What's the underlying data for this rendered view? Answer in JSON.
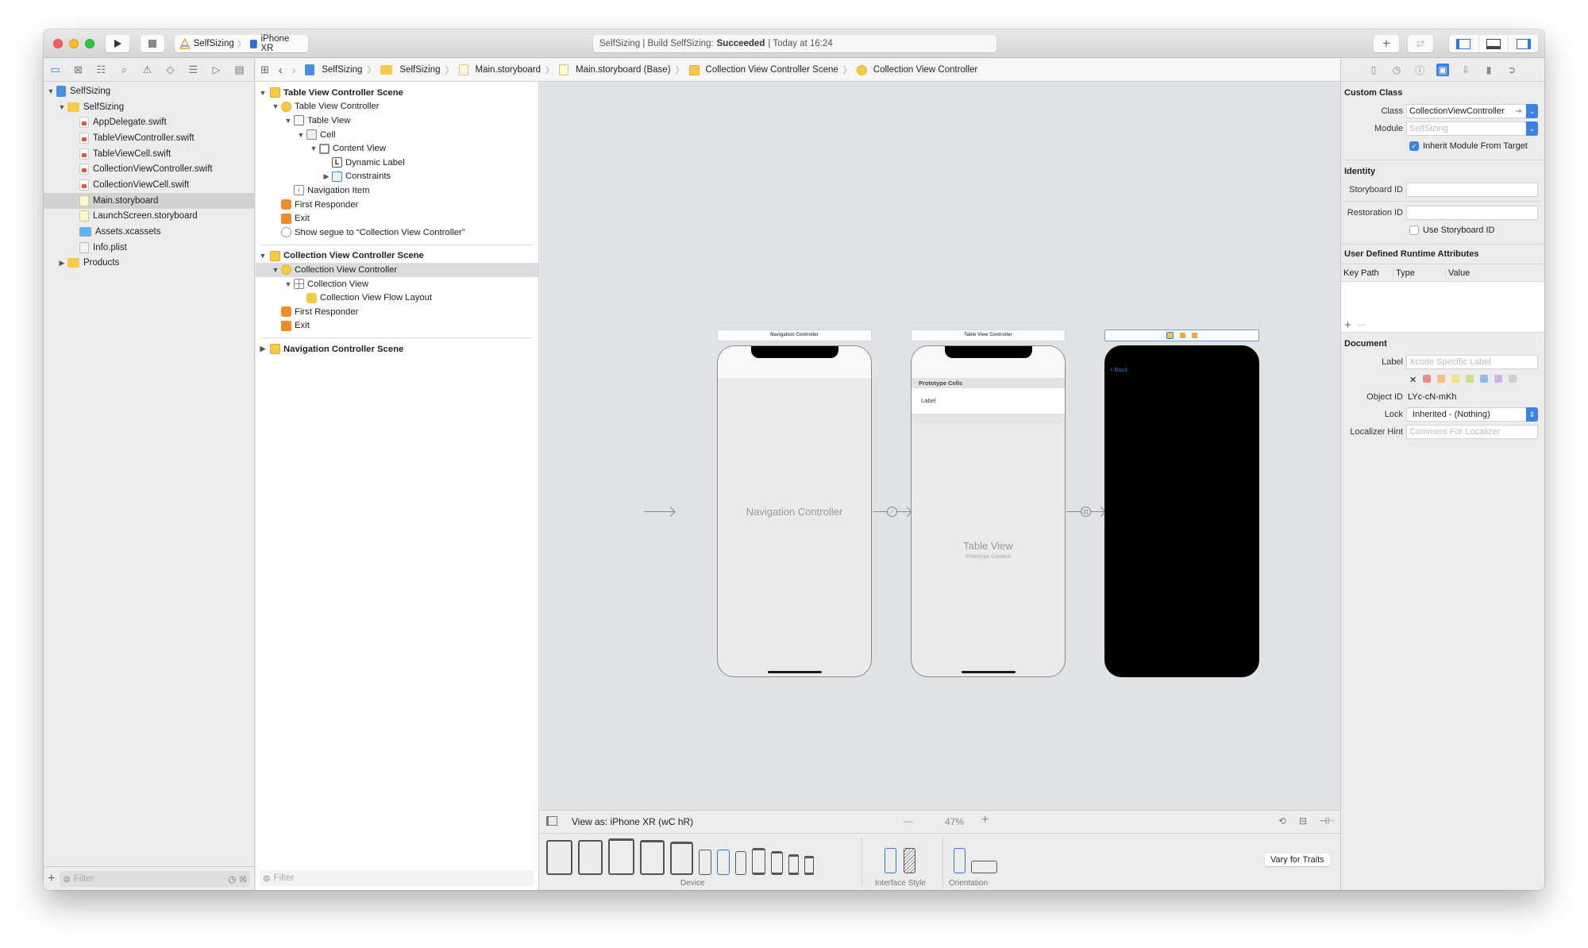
{
  "toolbar": {
    "scheme": "SelfSizing",
    "destination": "iPhone XR",
    "activity_prefix": "SelfSizing | Build SelfSizing:",
    "activity_status": "Succeeded",
    "activity_suffix": "| Today at 16:24"
  },
  "navigator": {
    "tabs": [
      "folder-icon",
      "source-control-icon",
      "symbol-icon",
      "search-icon",
      "warning-icon",
      "test-icon",
      "debug-icon",
      "breakpoint-icon",
      "report-icon"
    ],
    "project": "SelfSizing",
    "group": "SelfSizing",
    "files": [
      {
        "name": "AppDelegate.swift",
        "type": "swift"
      },
      {
        "name": "TableViewController.swift",
        "type": "swift"
      },
      {
        "name": "TableViewCell.swift",
        "type": "swift"
      },
      {
        "name": "CollectionViewController.swift",
        "type": "swift"
      },
      {
        "name": "CollectionViewCell.swift",
        "type": "swift"
      },
      {
        "name": "Main.storyboard",
        "type": "storyboard",
        "selected": true
      },
      {
        "name": "LaunchScreen.storyboard",
        "type": "storyboard"
      },
      {
        "name": "Assets.xcassets",
        "type": "assets"
      },
      {
        "name": "Info.plist",
        "type": "plist"
      }
    ],
    "products": "Products",
    "filter_placeholder": "Filter"
  },
  "pathbar": {
    "crumbs": [
      "SelfSizing",
      "SelfSizing",
      "Main.storyboard",
      "Main.storyboard (Base)",
      "Collection View Controller Scene",
      "Collection View Controller"
    ]
  },
  "outline": {
    "table_scene": "Table View Controller Scene",
    "table_vc": "Table View Controller",
    "table_view": "Table View",
    "cell": "Cell",
    "content_view": "Content View",
    "dynamic_label": "Dynamic Label",
    "constraints": "Constraints",
    "navigation_item": "Navigation Item",
    "first_responder": "First Responder",
    "exit": "Exit",
    "segue": "Show segue to “Collection View Controller”",
    "collection_scene": "Collection View Controller Scene",
    "collection_vc": "Collection View Controller",
    "collection_view": "Collection View",
    "flow_layout": "Collection View Flow Layout",
    "first_responder_2": "First Responder",
    "exit_2": "Exit",
    "nav_scene": "Navigation Controller Scene",
    "filter_placeholder": "Filter"
  },
  "canvas": {
    "nav_title": "Navigation Controller",
    "nav_body": "Navigation Controller",
    "table_title": "Table View Controller",
    "prototype_cells": "Prototype Cells",
    "cell_label": "Label",
    "table_view": "Table View",
    "prototype_content": "Prototype Content",
    "back": "Back"
  },
  "bottom_bar": {
    "view_as": "View as: iPhone XR (wC hR)",
    "zoom": "47%",
    "zoom_out": "—",
    "zoom_in": "+"
  },
  "device_bar": {
    "device_label": "Device",
    "interface_style_label": "Interface Style",
    "orientation_label": "Orientation",
    "vary_for_traits": "Vary for Traits"
  },
  "inspector": {
    "custom_class": {
      "header": "Custom Class",
      "class_label": "Class",
      "class_value": "CollectionViewController",
      "module_label": "Module",
      "module_placeholder": "SelfSizing",
      "inherit": "Inherit Module From Target",
      "inherit_checked": true
    },
    "identity": {
      "header": "Identity",
      "storyboard_id_label": "Storyboard ID",
      "storyboard_id_value": "",
      "restoration_id_label": "Restoration ID",
      "restoration_id_value": "",
      "use_storyboard_id": "Use Storyboard ID",
      "use_storyboard_checked": false
    },
    "runtime": {
      "header": "User Defined Runtime Attributes",
      "cols": [
        "Key Path",
        "Type",
        "Value"
      ],
      "add": "+",
      "remove": "—"
    },
    "document": {
      "header": "Document",
      "label_label": "Label",
      "label_placeholder": "Xcode Specific Label",
      "colors": [
        "#ee8a8a",
        "#f5c07a",
        "#f4e37a",
        "#c9e08a",
        "#8fbcf0",
        "#cdb2ec",
        "#cfcfcf"
      ],
      "object_id_label": "Object ID",
      "object_id_value": "LYc-cN-mKh",
      "lock_label": "Lock",
      "lock_value": "Inherited - (Nothing)",
      "localizer_label": "Localizer Hint",
      "localizer_placeholder": "Comment For Localizer"
    }
  },
  "colors": {
    "accent": "#3b82e8",
    "canvas_bg": "#e1e2e6",
    "success_text": "#333333"
  }
}
